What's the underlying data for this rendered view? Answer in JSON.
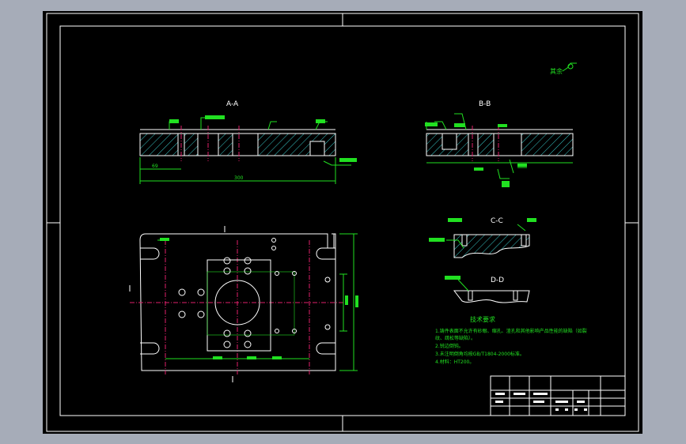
{
  "sections": {
    "aa": "A-A",
    "bb": "B-B",
    "cc": "C-C",
    "dd": "D-D"
  },
  "dims": {
    "overall_length": "300",
    "left_offset": "69"
  },
  "roughness_note": "其余",
  "tech_req": {
    "title": "技术要求",
    "items": [
      "1.铸件表面不允许有砂眼、缩孔、渣孔和其他影响产品性能的缺陷（如裂",
      "纹、疏松等缺陷）。",
      "2.锐边倒钝。",
      "3.未注明倒角均按GB/T1804-2000标准。",
      "4.材料：HT200。"
    ]
  },
  "colors": {
    "background": "#000000",
    "outline": "#ffffff",
    "dimension": "#21e021",
    "centerline": "#e0206a",
    "hatch": "#39c8c8"
  }
}
